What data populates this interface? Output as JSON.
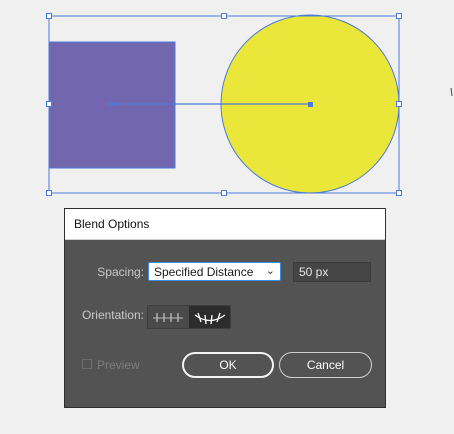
{
  "colors": {
    "background": "#f0f0f0",
    "square_fill": "#7266ae",
    "circle_fill": "#eae63a",
    "selection": "#4a7bd8",
    "dialog_bg": "#535353"
  },
  "dialog": {
    "title": "Blend Options",
    "spacing_label": "Spacing:",
    "spacing_value": "Specified Distance",
    "spacing_options": [
      "Specified Distance"
    ],
    "distance_value": "50 px",
    "orientation_label": "Orientation:",
    "orientation_options": [
      {
        "name": "align-to-page",
        "selected": false
      },
      {
        "name": "align-to-path",
        "selected": true
      }
    ],
    "preview_label": "Preview",
    "preview_checked": false,
    "preview_enabled": false,
    "ok_label": "OK",
    "cancel_label": "Cancel"
  }
}
